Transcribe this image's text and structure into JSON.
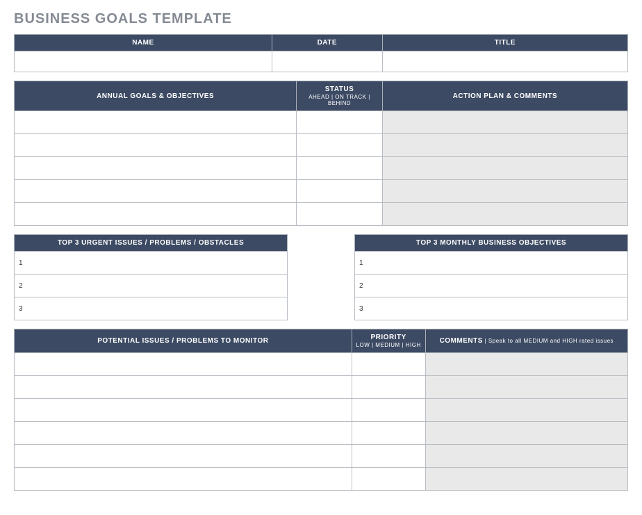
{
  "page": {
    "title": "BUSINESS GOALS TEMPLATE"
  },
  "info": {
    "name_label": "NAME",
    "date_label": "DATE",
    "title_label": "TITLE",
    "name_value": "",
    "date_value": "",
    "title_value": ""
  },
  "annual": {
    "goals_label": "ANNUAL GOALS & OBJECTIVES",
    "status_label": "STATUS",
    "status_sub": "AHEAD | ON TRACK | BEHIND",
    "action_label": "ACTION PLAN & COMMENTS",
    "rows": [
      {
        "goal": "",
        "status": "",
        "action": ""
      },
      {
        "goal": "",
        "status": "",
        "action": ""
      },
      {
        "goal": "",
        "status": "",
        "action": ""
      },
      {
        "goal": "",
        "status": "",
        "action": ""
      },
      {
        "goal": "",
        "status": "",
        "action": ""
      }
    ]
  },
  "urgent": {
    "label": "TOP 3 URGENT ISSUES / PROBLEMS / OBSTACLES",
    "rows": [
      {
        "num": "1",
        "value": ""
      },
      {
        "num": "2",
        "value": ""
      },
      {
        "num": "3",
        "value": ""
      }
    ]
  },
  "monthly": {
    "label": "TOP 3 MONTHLY BUSINESS OBJECTIVES",
    "rows": [
      {
        "num": "1",
        "value": ""
      },
      {
        "num": "2",
        "value": ""
      },
      {
        "num": "3",
        "value": ""
      }
    ]
  },
  "potential": {
    "issues_label": "POTENTIAL ISSUES / PROBLEMS TO MONITOR",
    "priority_label": "PRIORITY",
    "priority_sub": "LOW | MEDIUM | HIGH",
    "comments_label": "COMMENTS",
    "comments_sub": " | Speak to all MEDIUM and HIGH rated issues",
    "rows": [
      {
        "issue": "",
        "priority": "",
        "comment": ""
      },
      {
        "issue": "",
        "priority": "",
        "comment": ""
      },
      {
        "issue": "",
        "priority": "",
        "comment": ""
      },
      {
        "issue": "",
        "priority": "",
        "comment": ""
      },
      {
        "issue": "",
        "priority": "",
        "comment": ""
      },
      {
        "issue": "",
        "priority": "",
        "comment": ""
      }
    ]
  }
}
